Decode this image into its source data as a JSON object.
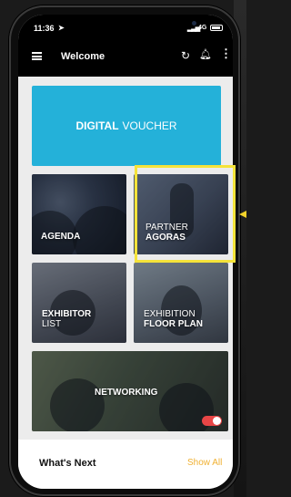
{
  "status_bar": {
    "time": "11:36",
    "location_icon": "location-arrow-icon",
    "network": "4G"
  },
  "app_bar": {
    "title": "Welcome",
    "icons": [
      "menu-icon",
      "refresh-icon",
      "bell-icon",
      "more-icon"
    ]
  },
  "tiles": {
    "voucher": {
      "bold": "DIGITAL",
      "light": "VOUCHER"
    },
    "agenda": {
      "label": "AGENDA"
    },
    "partner": {
      "line1": "PARTNER",
      "line2": "AGORAS"
    },
    "exhibitor": {
      "line1": "EXHIBITOR",
      "line2": "LIST"
    },
    "floor": {
      "line1": "EXHIBITION",
      "line2": "FLOOR PLAN"
    },
    "networking": {
      "label": "NETWORKING"
    }
  },
  "whats_next": {
    "title": "What's Next",
    "action": "Show All"
  },
  "colors": {
    "accent": "#24b1d9",
    "highlight": "#f5e33a",
    "show_all": "#f0b133",
    "toggle": "#e84646"
  }
}
